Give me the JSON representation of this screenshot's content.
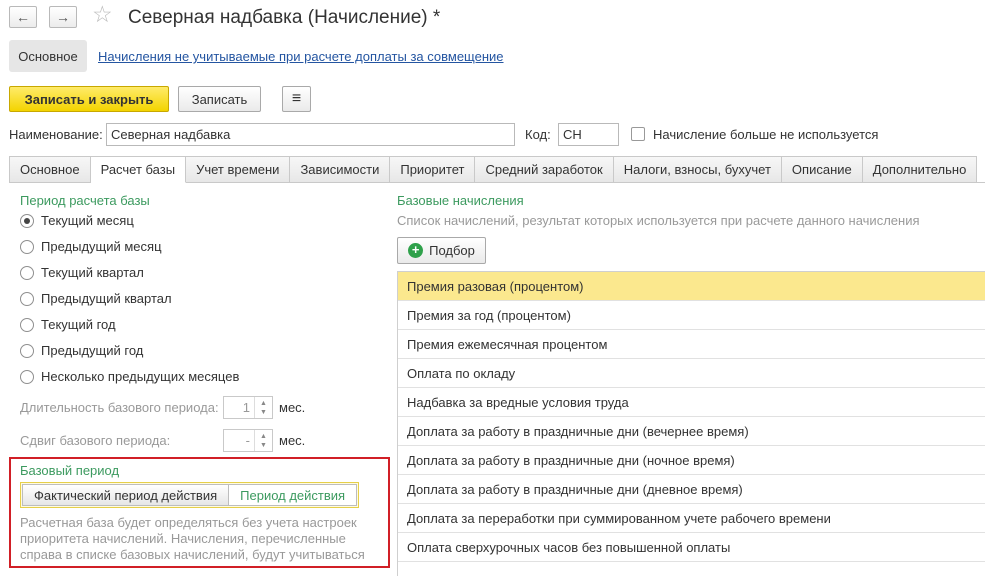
{
  "window": {
    "title": "Северная надбавка (Начисление) *",
    "back_icon": "←",
    "forward_icon": "→",
    "star_icon": "☆"
  },
  "sections": {
    "main": "Основное",
    "link": "Начисления не учитываемые при расчете доплаты за совмещение"
  },
  "toolbar": {
    "save_close": "Записать и закрыть",
    "save": "Записать",
    "more_icon": "≡"
  },
  "form": {
    "name_label": "Наименование:",
    "name_value": "Северная надбавка",
    "code_label": "Код:",
    "code_value": "СН",
    "not_used_label": "Начисление больше не используется"
  },
  "tabs": [
    "Основное",
    "Расчет базы",
    "Учет времени",
    "Зависимости",
    "Приоритет",
    "Средний заработок",
    "Налоги, взносы, бухучет",
    "Описание",
    "Дополнительно"
  ],
  "period": {
    "heading": "Период расчета базы",
    "options": [
      "Текущий месяц",
      "Предыдущий месяц",
      "Текущий квартал",
      "Предыдущий квартал",
      "Текущий год",
      "Предыдущий год",
      "Несколько предыдущих месяцев"
    ],
    "duration_label": "Длительность базового периода:",
    "duration_value": "1",
    "shift_label": "Сдвиг базового периода:",
    "shift_value": "-",
    "unit": "мес."
  },
  "base_period": {
    "heading": "Базовый период",
    "option_actual": "Фактический период действия",
    "option_action": "Период действия",
    "info": "Расчетная база будет определяться без учета настроек приоритета начислений. Начисления, перечисленные справа в списке базовых начислений, будут учитываться при расчете этого начисления."
  },
  "base_accruals": {
    "heading": "Базовые начисления",
    "description": "Список начислений, результат которых используется при расчете данного начисления",
    "add_button": "Подбор",
    "add_icon": "+",
    "items": [
      "Премия разовая (процентом)",
      "Премия за год (процентом)",
      "Премия ежемесячная процентом",
      "Оплата по окладу",
      "Надбавка за вредные условия труда",
      "Доплата за работу в праздничные дни (вечернее время)",
      "Доплата за работу в праздничные дни (ночное время)",
      "Доплата за работу в праздничные дни (дневное время)",
      "Доплата за переработки при суммированном учете рабочего времени",
      "Оплата сверхурочных часов без повышенной оплаты"
    ]
  }
}
